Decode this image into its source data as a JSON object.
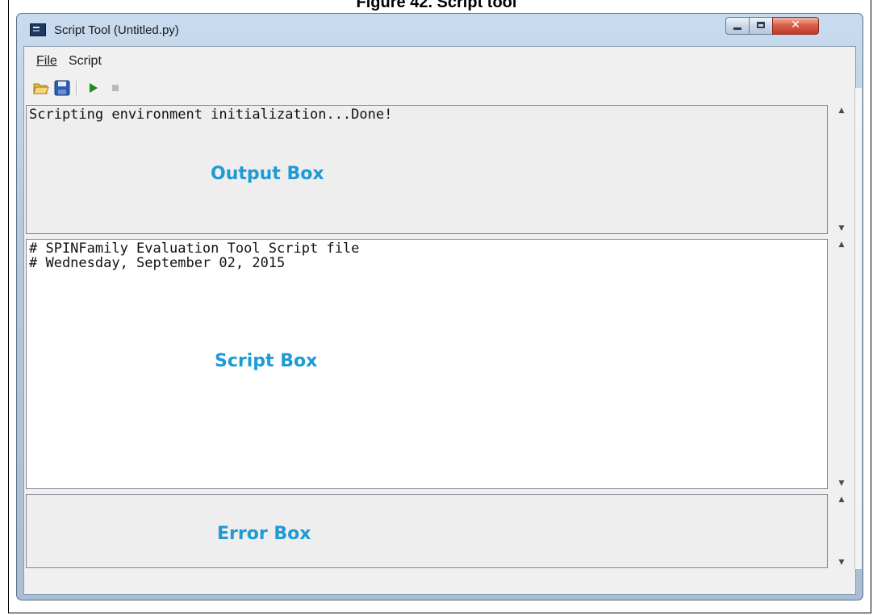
{
  "heading": "Figure 42. Script tool",
  "window": {
    "title": "Script Tool (Untitled.py)"
  },
  "menu": {
    "file_label": "File",
    "script_label": "Script"
  },
  "toolbar": {
    "open_icon": "open-folder-icon",
    "save_icon": "save-disk-icon",
    "run_icon": "run-icon",
    "stop_icon": "stop-icon"
  },
  "output_box": {
    "text": "Scripting environment initialization...Done!",
    "label": "Output Box"
  },
  "script_box": {
    "lines": [
      "# SPINFamily Evaluation Tool Script file",
      "# Wednesday, September 02, 2015"
    ],
    "label": "Script Box"
  },
  "error_box": {
    "text": "",
    "label": "Error Box"
  },
  "colors": {
    "annotation": "#1e9ad6",
    "close_button": "#c0392b",
    "run_icon": "#1f8a1f"
  }
}
